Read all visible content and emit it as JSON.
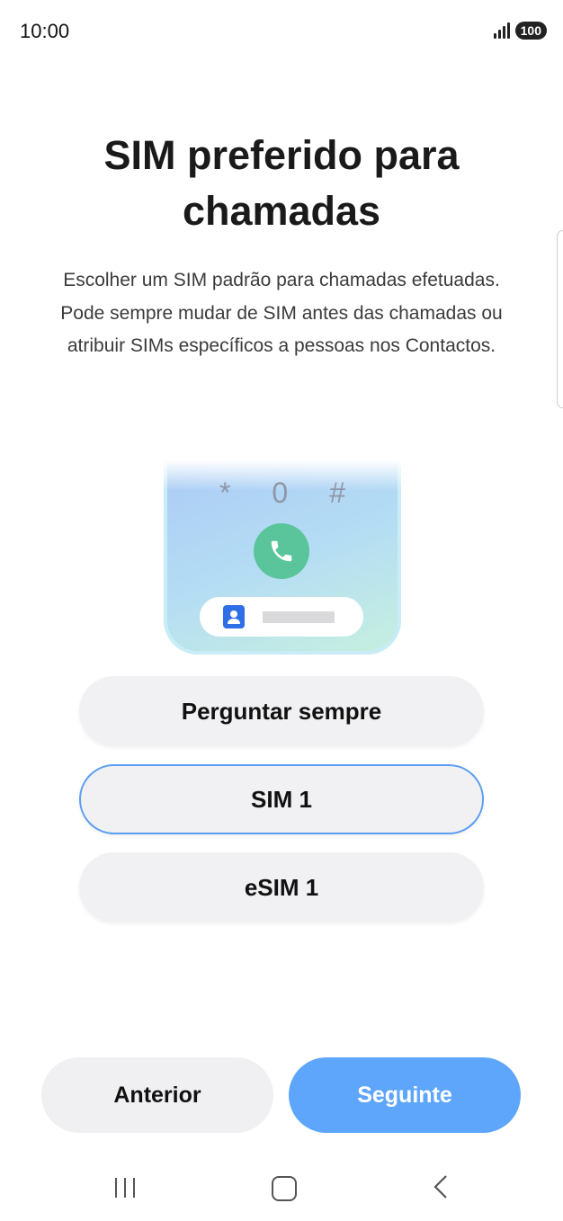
{
  "status_bar": {
    "time": "10:00",
    "battery": "100",
    "icons": [
      "signal-icon",
      "battery-icon"
    ]
  },
  "title": "SIM preferido para chamadas",
  "description": "Escolher um SIM padrão para chamadas efetuadas. Pode sempre mudar de SIM antes das chamadas ou atribuir SIMs específicos a pessoas nos Contactos.",
  "illustration": {
    "keys": [
      "*",
      "0",
      "#"
    ],
    "icons": [
      "phone-icon",
      "contact-icon"
    ]
  },
  "options": [
    {
      "label": "Perguntar sempre",
      "selected": false
    },
    {
      "label": "SIM 1",
      "selected": true
    },
    {
      "label": "eSIM 1",
      "selected": false
    }
  ],
  "buttons": {
    "previous": "Anterior",
    "next": "Seguinte"
  },
  "nav_bar": {
    "icons": [
      "recent-apps-icon",
      "home-icon",
      "back-icon"
    ]
  },
  "colors": {
    "accent": "#5ea6fb",
    "selected_border": "#5b9ef0",
    "call_green": "#5ac49a"
  }
}
